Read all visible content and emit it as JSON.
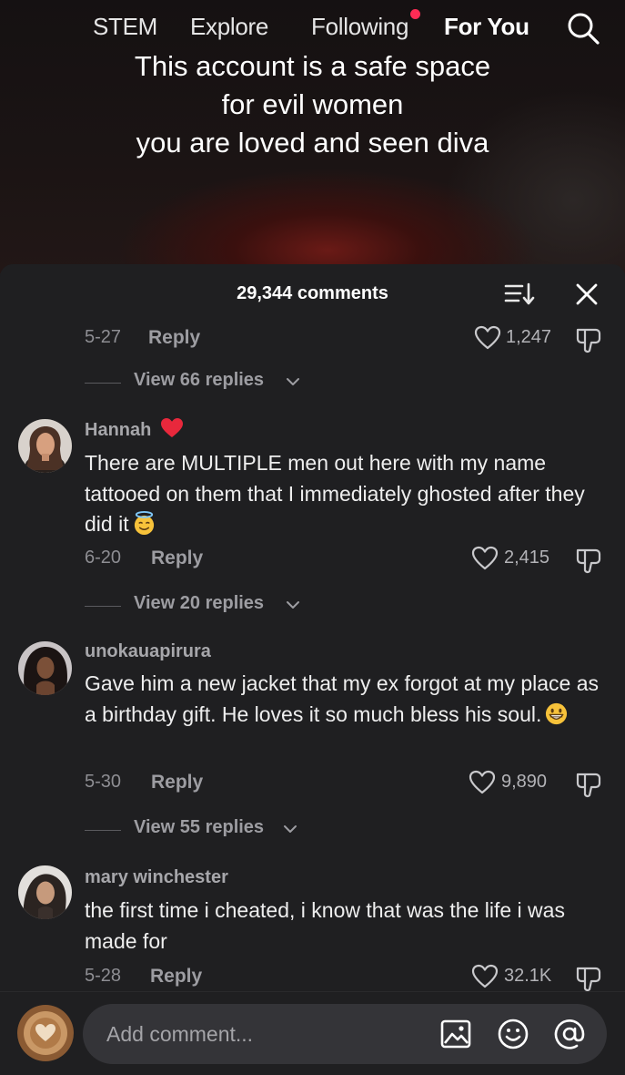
{
  "nav": {
    "tabs": [
      {
        "label": "STEM"
      },
      {
        "label": "Explore"
      },
      {
        "label": "Following",
        "notification_dot": true
      },
      {
        "label": "For You",
        "active": true
      }
    ],
    "search_icon": "search-icon"
  },
  "video": {
    "caption": [
      "This account is a safe space",
      "for evil women",
      "you are loved and seen diva"
    ]
  },
  "comments_sheet": {
    "count_label": "29,344 comments",
    "sort_icon": "sort-icon",
    "close_icon": "close-icon",
    "first_meta": {
      "date": "5-27",
      "reply": "Reply",
      "likes": "1,247"
    },
    "first_view_replies": "View 66 replies",
    "comments": [
      {
        "username": "Hannah",
        "username_emoji": "red-heart",
        "text": "There are MULTIPLE men out here with my name tattooed on them that I immediately ghosted after they did it",
        "text_emoji": "smiling-face-with-halo",
        "date": "6-20",
        "reply": "Reply",
        "likes": "2,415",
        "view_replies": "View 20 replies"
      },
      {
        "username": "unokauapirura",
        "text": "Gave him a new jacket that my ex forgot at my place as a birthday gift. He loves it so much bless his soul.",
        "text_emoji": "grinning-face",
        "date": "5-30",
        "reply": "Reply",
        "likes": "9,890",
        "view_replies": "View 55 replies"
      },
      {
        "username": "mary winchester",
        "text": "the first time i cheated, i know that was the life i was made for",
        "date": "5-28",
        "reply": "Reply",
        "likes": "32.1K"
      }
    ]
  },
  "composer": {
    "placeholder": "Add comment...",
    "icons": [
      "image-icon",
      "emoji-icon",
      "mention-icon"
    ]
  },
  "colors": {
    "sheet_bg": "#1f1f21",
    "input_bg": "#343438",
    "accent_dot": "#fe2c55",
    "heart_red": "#e8283c"
  }
}
